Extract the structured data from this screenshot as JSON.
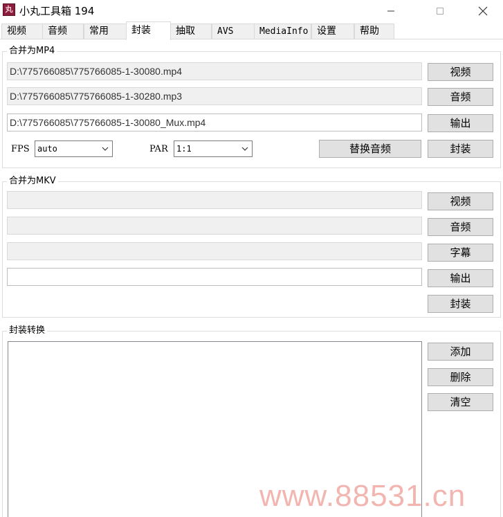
{
  "window": {
    "title": "小丸工具箱 194",
    "icon_glyph": "丸",
    "controls": {
      "minimize": "minimize-icon",
      "maximize": "maximize-icon",
      "close": "close-icon"
    }
  },
  "tabs": [
    {
      "label": "视频",
      "active": false
    },
    {
      "label": "音频",
      "active": false
    },
    {
      "label": "常用",
      "active": false
    },
    {
      "label": "封装",
      "active": true
    },
    {
      "label": "抽取",
      "active": false
    },
    {
      "label": "AVS",
      "active": false
    },
    {
      "label": "MediaInfo",
      "active": false
    },
    {
      "label": "设置",
      "active": false
    },
    {
      "label": "帮助",
      "active": false
    }
  ],
  "mp4": {
    "legend": "合并为MP4",
    "video_path": "D:\\775766085\\775766085-1-30080.mp4",
    "audio_path": "D:\\775766085\\775766085-1-30280.mp3",
    "output_path": "D:\\775766085\\775766085-1-30080_Mux.mp4",
    "video_button": "视频",
    "audio_button": "音频",
    "output_button": "输出",
    "fps_label": "FPS",
    "fps_value": "auto",
    "par_label": "PAR",
    "par_value": "1:1",
    "replace_audio_button": "替换音频",
    "mux_button": "封装"
  },
  "mkv": {
    "legend": "合并为MKV",
    "video_path": "",
    "audio_path": "",
    "subtitle_path": "",
    "output_path": "",
    "video_button": "视频",
    "audio_button": "音频",
    "subtitle_button": "字幕",
    "output_button": "输出",
    "mux_button": "封装"
  },
  "convert": {
    "legend": "封装转换",
    "files": [],
    "add_button": "添加",
    "delete_button": "删除",
    "clear_button": "清空"
  },
  "watermark": "www.88531.cn",
  "colors": {
    "app_icon": "#8b1e3f",
    "watermark": "#f2b5b0"
  }
}
